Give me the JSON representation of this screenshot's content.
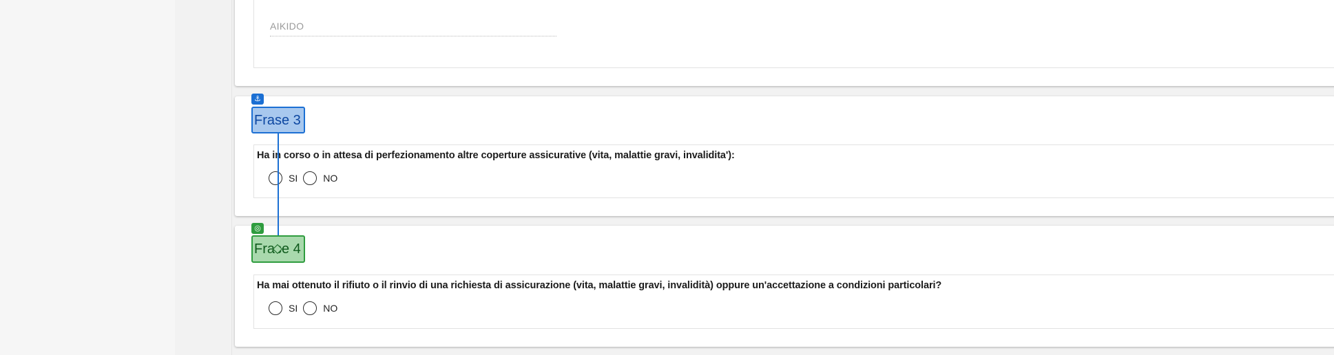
{
  "fields": {
    "sport_value": "AIKIDO"
  },
  "sections": [
    {
      "tag": "Frase 3",
      "question": "Ha in corso o in attesa di perfezionamento altre coperture assicurative (vita, malattie gravi, invalidita'):",
      "options": [
        "SI",
        "NO"
      ]
    },
    {
      "tag": "Frase 4",
      "question": "Ha mai ottenuto il rifiuto o il rinvio di una richiesta di assicurazione (vita, malattie gravi, invalidità) oppure un'accettazione a condizioni particolari?",
      "options": [
        "SI",
        "NO"
      ]
    }
  ],
  "annotation": {
    "source_icon": "anchor-icon",
    "target_icon": "target-icon",
    "source_color": "#1b6fd3",
    "target_color": "#2e9c3e"
  }
}
